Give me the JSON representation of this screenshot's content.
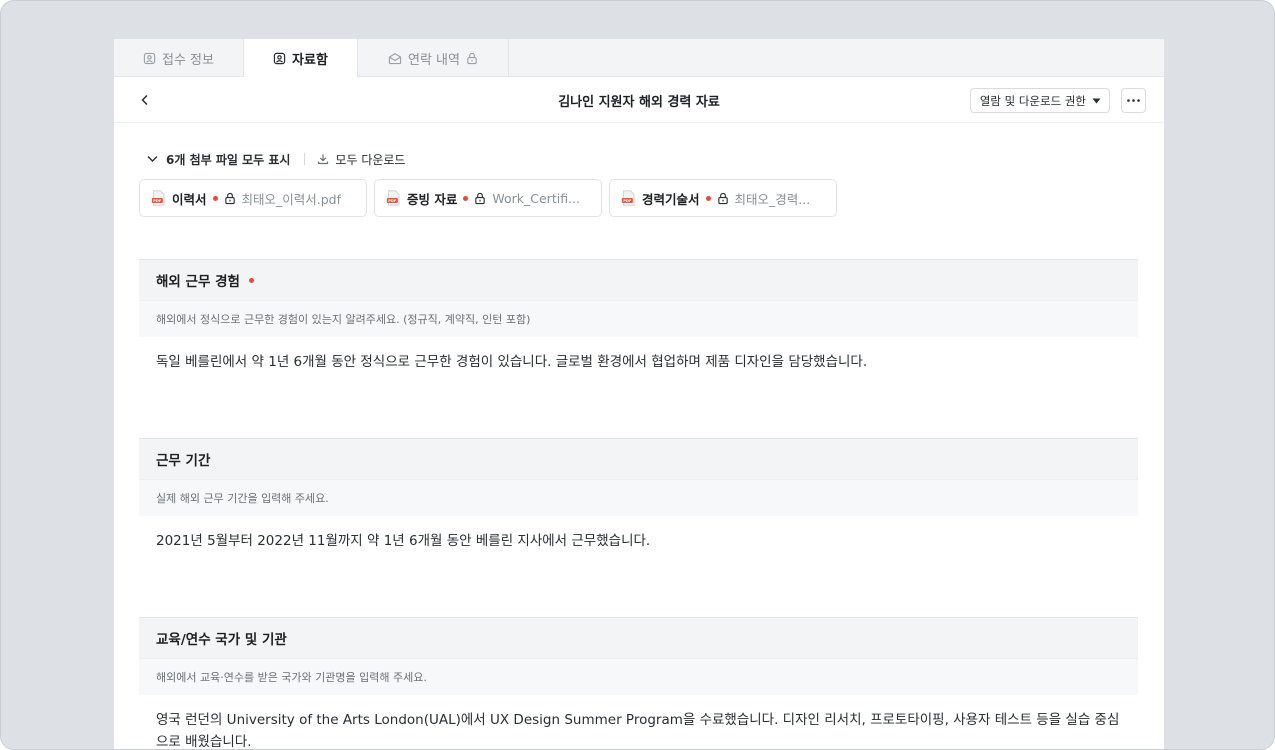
{
  "tabs": [
    {
      "label": "접수 정보",
      "icon": "user-card-icon"
    },
    {
      "label": "자료함",
      "icon": "user-card-icon"
    },
    {
      "label": "연락 내역",
      "icon": "envelope-icon",
      "trailing_icon": "lock-icon"
    }
  ],
  "active_tab": 1,
  "header": {
    "title": "김나인 지원자 해외 경력 자료",
    "permission_label": "열람 및 다운로드 권한"
  },
  "attachments": {
    "toggle_label": "6개 첨부 파일 모두 표시",
    "download_all_label": "모두 다운로드",
    "files": [
      {
        "name": "이력서",
        "file": "최태오_이력서.pdf"
      },
      {
        "name": "증빙 자료",
        "file": "Work_Certifi..."
      },
      {
        "name": "경력기술서",
        "file": "최태오_경력..."
      }
    ]
  },
  "sections": [
    {
      "title": "해외 근무 경험",
      "required": true,
      "description": "해외에서 정식으로 근무한 경험이 있는지 알려주세요. (정규직, 계약직, 인턴 포함)",
      "answer": "독일 베를린에서 약 1년 6개월 동안 정식으로 근무한 경험이 있습니다. 글로벌 환경에서 협업하며 제품 디자인을 담당했습니다."
    },
    {
      "title": "근무 기간",
      "required": false,
      "description": "실제 해외 근무 기간을 입력해 주세요.",
      "answer": "2021년 5월부터 2022년 11월까지 약 1년 6개월 동안 베를린 지사에서 근무했습니다."
    },
    {
      "title": "교육/연수 국가 및 기관",
      "required": false,
      "description": "해외에서 교육·연수를 받은 국가와 기관명을 입력해 주세요.",
      "answer": "영국 런던의 University of the Arts London(UAL)에서 UX Design Summer Program을 수료했습니다. 디자인 리서치, 프로토타이핑, 사용자 테스트 등을 실습 중심으로 배웠습니다."
    }
  ],
  "colors": {
    "required_dot": "#e54a3d",
    "pdf_icon": "#e8553d",
    "background": "#dde1e6"
  }
}
